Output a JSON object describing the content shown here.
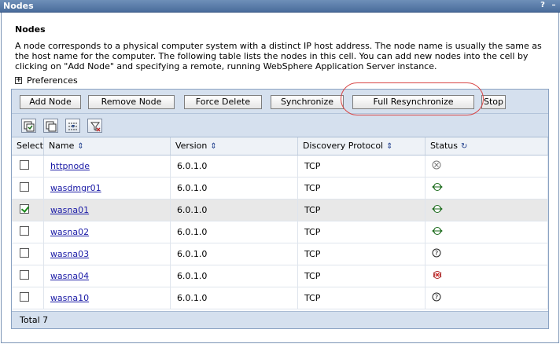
{
  "window": {
    "title": "Nodes",
    "help_icon": "?",
    "minimize_icon": "–"
  },
  "page": {
    "heading": "Nodes",
    "description": "A node corresponds to a physical computer system with a distinct IP host address. The node name is usually the same as the host name for the computer. The following table lists the nodes in this cell. You can add new nodes into the cell by clicking on \"Add Node\" and specifying a remote, running WebSphere Application Server instance.",
    "preferences_label": "Preferences"
  },
  "toolbar": {
    "add_node": "Add Node",
    "remove_node": "Remove Node",
    "force_delete": "Force Delete",
    "synchronize": "Synchronize",
    "full_resync": "Full Resynchronize",
    "stop": "Stop"
  },
  "icon_toolbar": [
    "select-all-icon",
    "deselect-all-icon",
    "show-filter-icon",
    "clear-filter-icon"
  ],
  "table": {
    "headers": {
      "select": "Select",
      "name": "Name",
      "version": "Version",
      "discovery": "Discovery Protocol",
      "status": "Status"
    },
    "rows": [
      {
        "name": "httpnode",
        "version": "6.0.1.0",
        "protocol": "TCP",
        "status": "not-applicable",
        "checked": false
      },
      {
        "name": "wasdmgr01",
        "version": "6.0.1.0",
        "protocol": "TCP",
        "status": "synchronized",
        "checked": false
      },
      {
        "name": "wasna01",
        "version": "6.0.1.0",
        "protocol": "TCP",
        "status": "synchronized",
        "checked": true
      },
      {
        "name": "wasna02",
        "version": "6.0.1.0",
        "protocol": "TCP",
        "status": "synchronized",
        "checked": false
      },
      {
        "name": "wasna03",
        "version": "6.0.1.0",
        "protocol": "TCP",
        "status": "unknown",
        "checked": false
      },
      {
        "name": "wasna04",
        "version": "6.0.1.0",
        "protocol": "TCP",
        "status": "not-synchronized",
        "checked": false
      },
      {
        "name": "wasna10",
        "version": "6.0.1.0",
        "protocol": "TCP",
        "status": "unknown",
        "checked": false
      }
    ],
    "total": "Total 7"
  }
}
